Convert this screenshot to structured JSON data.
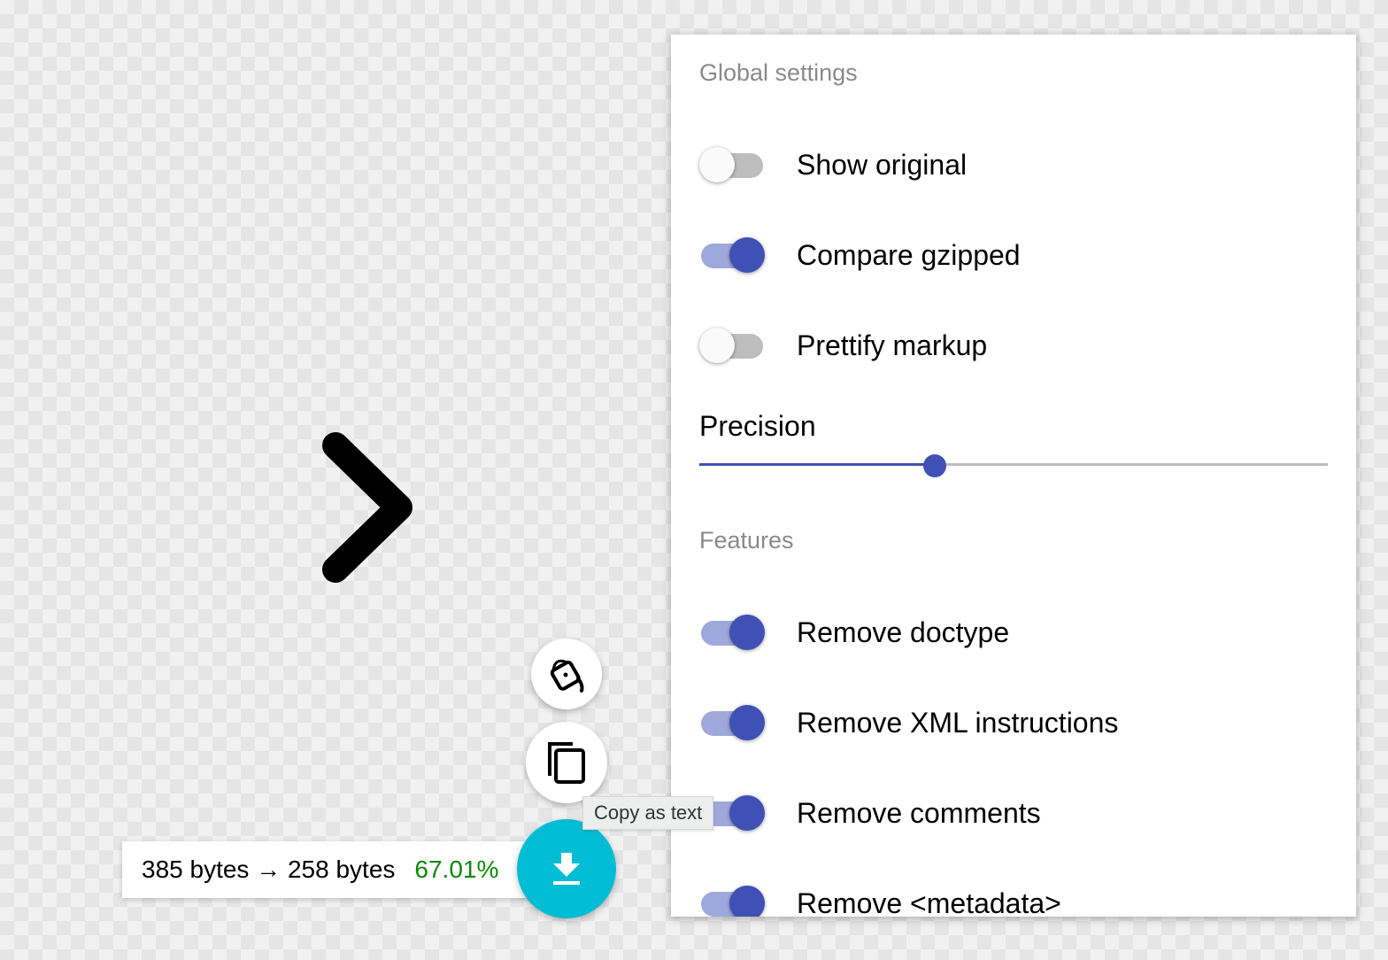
{
  "settings": {
    "global_title": "Global settings",
    "global": [
      {
        "label": "Show original",
        "on": false
      },
      {
        "label": "Compare gzipped",
        "on": true
      },
      {
        "label": "Prettify markup",
        "on": false
      }
    ],
    "precision": {
      "label": "Precision",
      "fill_fraction": 0.375
    },
    "features_title": "Features",
    "features": [
      {
        "label": "Remove doctype",
        "on": true
      },
      {
        "label": "Remove XML instructions",
        "on": true
      },
      {
        "label": "Remove comments",
        "on": true
      },
      {
        "label": "Remove <metadata>",
        "on": true
      }
    ]
  },
  "results": {
    "original": "385 bytes",
    "arrow": "→",
    "optimized": "258 bytes",
    "percent": "67.01%"
  },
  "tooltip": "Copy as text",
  "icons": {
    "preview": "chevron-right-icon",
    "bg": "paint-bucket-icon",
    "copy": "copy-icon",
    "download": "download-icon"
  },
  "colors": {
    "accent": "#3f51b5",
    "download_fab": "#00bcd4",
    "savings": "#0a8a0a"
  }
}
